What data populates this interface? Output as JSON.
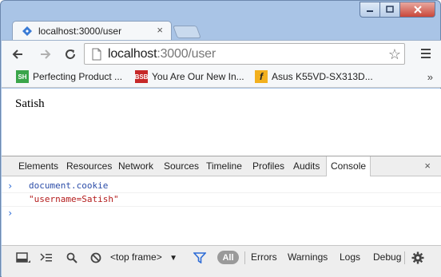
{
  "tab": {
    "title": "localhost:3000/user",
    "close": "×"
  },
  "address": {
    "host": "localhost",
    "path": ":3000/user",
    "star": "☆"
  },
  "bookmarks": [
    {
      "label": "Perfecting Product ...",
      "icon_text": "SH",
      "icon_color": "#3aa54a"
    },
    {
      "label": "You Are Our New In...",
      "icon_text": "BSB",
      "icon_color": "#c62828"
    },
    {
      "label": "Asus K55VD-SX313D...",
      "icon_text": "f",
      "icon_color": "#f2b01e"
    }
  ],
  "bookmarks_more": "»",
  "page": {
    "text": "Satish"
  },
  "devtools": {
    "tabs": [
      "Elements",
      "Resources",
      "Network",
      "Sources",
      "Timeline",
      "Profiles",
      "Audits",
      "Console"
    ],
    "active_tab": "Console",
    "close": "×",
    "console": {
      "prompt": "›",
      "command": "document.cookie",
      "result": "\"username=Satish\""
    },
    "bottom": {
      "frame": "<top frame>",
      "frame_arrow": "▼",
      "all": "All",
      "filters": [
        "Errors",
        "Warnings",
        "Logs",
        "Debug"
      ]
    }
  },
  "colors": {
    "accent": "#2c6bd6",
    "result": "#b41c1c",
    "frame": "#a9c4e6"
  }
}
